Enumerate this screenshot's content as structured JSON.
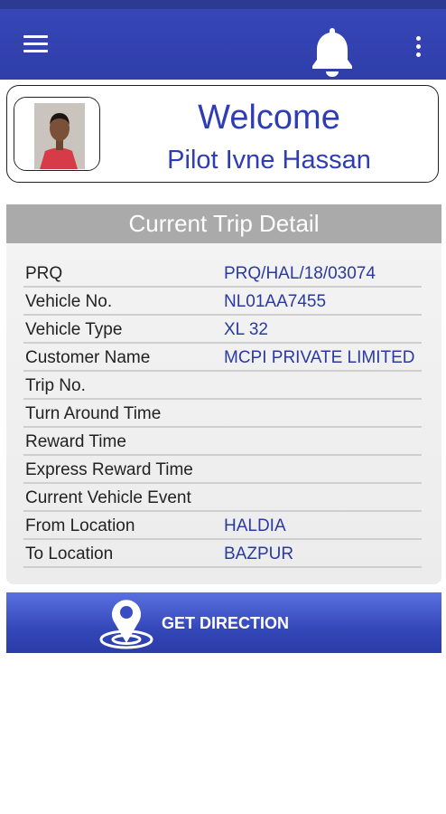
{
  "welcome": {
    "title": "Welcome",
    "pilot_name": "Pilot Ivne Hassan"
  },
  "trip": {
    "header": "Current Trip Detail",
    "rows": [
      {
        "label": "PRQ",
        "value": "PRQ/HAL/18/03074"
      },
      {
        "label": "Vehicle No.",
        "value": "NL01AA7455"
      },
      {
        "label": "Vehicle Type",
        "value": "XL 32"
      },
      {
        "label": "Customer Name",
        "value": "MCPI PRIVATE LIMITED"
      },
      {
        "label": "Trip No.",
        "value": ""
      },
      {
        "label": "Turn Around Time",
        "value": ""
      },
      {
        "label": "Reward Time",
        "value": ""
      },
      {
        "label": "Express Reward Time",
        "value": ""
      },
      {
        "label": "Current Vehicle Event",
        "value": ""
      },
      {
        "label": "From Location",
        "value": "HALDIA"
      },
      {
        "label": "To Location",
        "value": "BAZPUR"
      }
    ]
  },
  "actions": {
    "get_direction": "GET DIRECTION"
  },
  "icons": {
    "menu": "hamburger-menu-icon",
    "notifications": "bell-icon",
    "more": "more-vertical-icon",
    "direction": "map-pin-icon"
  },
  "colors": {
    "appbar": "#3646b8",
    "accent_text": "#2f3db4",
    "value_text": "#2a3aa0",
    "header_bg": "#aaaaaa"
  }
}
